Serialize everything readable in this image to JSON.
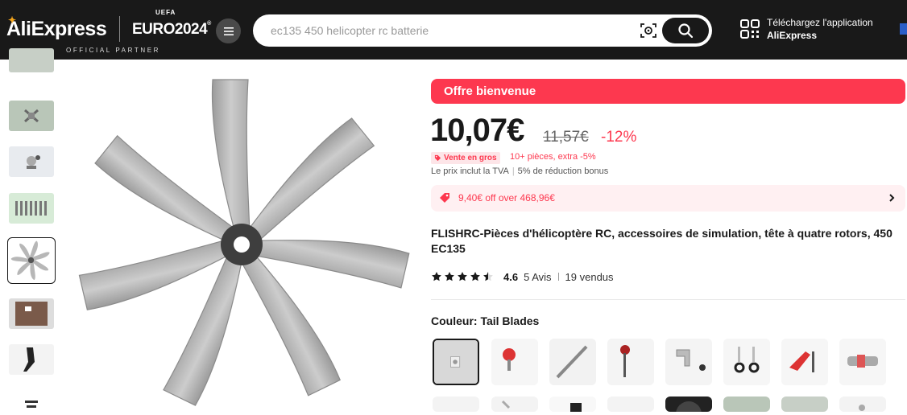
{
  "header": {
    "logo": "AliExpress",
    "euro_badge": "EURO2024",
    "uefa_label": "UEFA",
    "partner_label": "OFFICIAL PARTNER",
    "search_placeholder": "ec135 450 helicopter rc batterie",
    "app_line1": "Téléchargez l'application",
    "app_line2": "AliExpress"
  },
  "product": {
    "offer_banner": "Offre bienvenue",
    "price": "10,07€",
    "old_price": "11,57€",
    "discount": "-12%",
    "bulk_badge": "Vente en gros",
    "bulk_text": "10+ pièces, extra -5%",
    "tax_text": "Le prix inclut la TVA",
    "bonus_text": "5% de réduction bonus",
    "coupon_text": "9,40€ off over 468,96€",
    "title": "FLISHRC-Pièces d'hélicoptère RC, accessoires de simulation, tête à quatre rotors, 450 EC135",
    "rating": "4.6",
    "reviews": "5 Avis",
    "sold": "19 vendus",
    "color_label": "Couleur: Tail Blades",
    "stars_filled": 4.6
  },
  "colors": {
    "accent": "#fd384f",
    "header_bg": "#191919"
  }
}
